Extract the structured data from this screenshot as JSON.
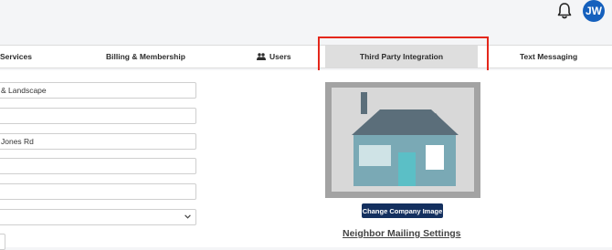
{
  "header": {
    "user_initials": "JW"
  },
  "tabs": [
    {
      "label": "Services"
    },
    {
      "label": "Billing & Membership"
    },
    {
      "label": "Users",
      "icon": "users-icon"
    },
    {
      "label": "Third Party Integration",
      "active": true
    },
    {
      "label": "Text Messaging"
    }
  ],
  "form": {
    "fields": [
      {
        "value": "& Landscape"
      },
      {
        "value": ""
      },
      {
        "value": "Jones Rd"
      },
      {
        "value": ""
      },
      {
        "value": ""
      },
      {
        "value": "",
        "type": "select"
      }
    ]
  },
  "company_image": {
    "button_label": "Change Company Image",
    "placeholder_icon": "house-icon"
  },
  "section": {
    "heading": "Neighbor Mailing Settings"
  },
  "colors": {
    "avatar": "#1560bd",
    "highlight": "#e4271b",
    "button": "#14305f",
    "house_body": "#7aa9b5",
    "house_roof": "#5b6e7a"
  }
}
